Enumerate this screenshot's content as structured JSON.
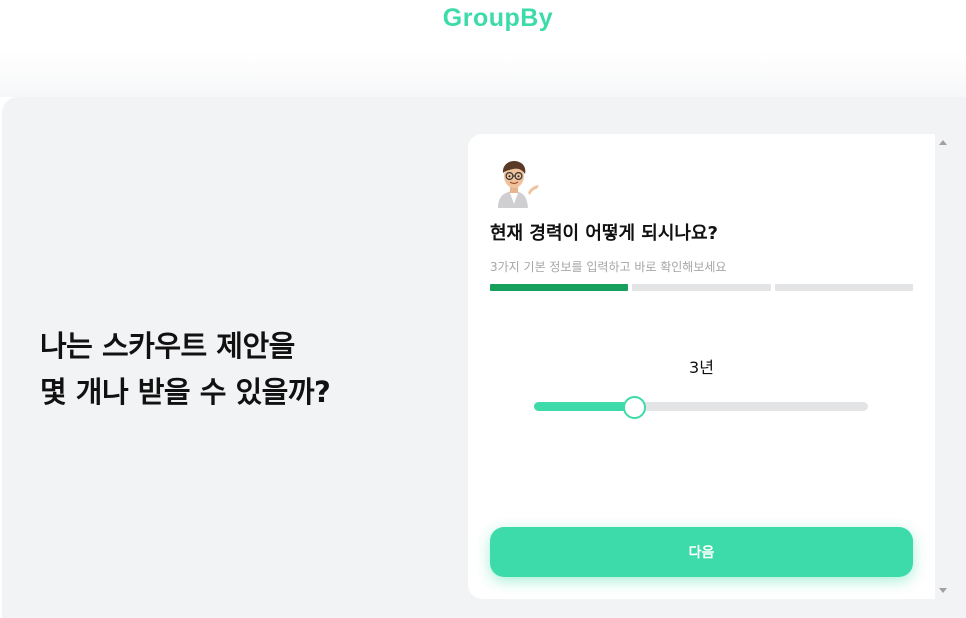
{
  "header": {
    "logo_text": "GroupBy",
    "brand_color": "#3ddba9"
  },
  "hero": {
    "line1": "나는 스카우트 제안을",
    "line2": "몇 개나 받을 수 있을까?"
  },
  "card": {
    "avatar_icon": "memoji-avatar-icon",
    "question": "현재 경력이 어떻게 되시나요?",
    "subtitle": "3가지 기본 정보를 입력하고 바로 확인해보세요",
    "progress": {
      "steps_total": 3,
      "steps_done": 1,
      "done_color": "#17a05d"
    },
    "slider": {
      "value_label": "3년",
      "value_fraction": 0.3
    },
    "next_button": {
      "label": "다음",
      "color": "#3ddba9"
    }
  },
  "scrollbar": {
    "up_icon": "scroll-up-arrow-icon",
    "down_icon": "scroll-down-arrow-icon"
  }
}
